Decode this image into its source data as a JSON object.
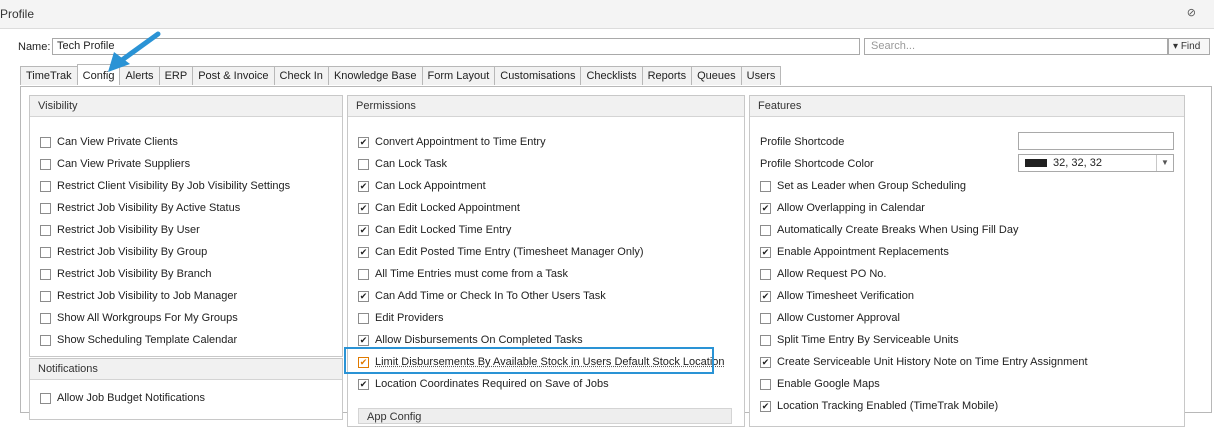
{
  "window": {
    "title": "Profile",
    "close": "⊘"
  },
  "name_row": {
    "label": "Name:",
    "value": "Tech Profile",
    "search_placeholder": "Search...",
    "find_label": "Find"
  },
  "tabs": [
    "TimeTrak",
    "Config",
    "Alerts",
    "ERP",
    "Post & Invoice",
    "Check In",
    "Knowledge Base",
    "Form Layout",
    "Customisations",
    "Checklists",
    "Reports",
    "Queues",
    "Users"
  ],
  "visibility": {
    "header": "Visibility",
    "items": [
      {
        "label": "Can View Private Clients",
        "checked": false
      },
      {
        "label": "Can View Private Suppliers",
        "checked": false
      },
      {
        "label": "Restrict Client Visibility By Job Visibility Settings",
        "checked": false
      },
      {
        "label": "Restrict Job Visibility By Active Status",
        "checked": false
      },
      {
        "label": "Restrict Job Visibility By User",
        "checked": false
      },
      {
        "label": "Restrict Job Visibility By Group",
        "checked": false
      },
      {
        "label": "Restrict Job Visibility By Branch",
        "checked": false
      },
      {
        "label": "Restrict Job Visibility to Job Manager",
        "checked": false
      },
      {
        "label": "Show All Workgroups For My Groups",
        "checked": false
      },
      {
        "label": "Show Scheduling Template Calendar",
        "checked": false
      }
    ]
  },
  "notifications": {
    "header": "Notifications",
    "items": [
      {
        "label": "Allow Job Budget Notifications",
        "checked": false
      }
    ]
  },
  "permissions": {
    "header": "Permissions",
    "items": [
      {
        "label": "Convert Appointment to Time Entry",
        "checked": true
      },
      {
        "label": "Can Lock Task",
        "checked": false
      },
      {
        "label": "Can Lock Appointment",
        "checked": true
      },
      {
        "label": "Can Edit Locked Appointment",
        "checked": true
      },
      {
        "label": "Can Edit Locked Time Entry",
        "checked": true
      },
      {
        "label": "Can Edit Posted Time Entry (Timesheet Manager Only)",
        "checked": true
      },
      {
        "label": "All Time Entries must come from a Task",
        "checked": false
      },
      {
        "label": "Can Add Time or Check In To Other Users Task",
        "checked": true
      },
      {
        "label": "Edit Providers",
        "checked": false
      },
      {
        "label": "Allow Disbursements On Completed Tasks",
        "checked": true
      },
      {
        "label": "Limit Disbursements By Available Stock in Users Default Stock Location",
        "checked": true
      },
      {
        "label": "Location Coordinates Required on Save of Jobs",
        "checked": true
      }
    ],
    "app_config": "App Config"
  },
  "features": {
    "header": "Features",
    "shortcode_label": "Profile Shortcode",
    "shortcode_color_label": "Profile Shortcode Color",
    "shortcode_color_value": "32, 32, 32",
    "shortcode_color_hex": "#202020",
    "items": [
      {
        "label": "Set as Leader when Group Scheduling",
        "checked": false
      },
      {
        "label": "Allow Overlapping in Calendar",
        "checked": true
      },
      {
        "label": "Automatically Create Breaks When Using Fill Day",
        "checked": false
      },
      {
        "label": "Enable Appointment Replacements",
        "checked": true
      },
      {
        "label": "Allow Request PO No.",
        "checked": false
      },
      {
        "label": "Allow Timesheet Verification",
        "checked": true
      },
      {
        "label": "Allow Customer Approval",
        "checked": false
      },
      {
        "label": "Split Time Entry By Serviceable Units",
        "checked": false
      },
      {
        "label": "Create Serviceable Unit History Note on Time Entry Assignment",
        "checked": true
      },
      {
        "label": "Enable Google Maps",
        "checked": false
      },
      {
        "label": "Location Tracking Enabled (TimeTrak Mobile)",
        "checked": true
      }
    ]
  },
  "colors": {
    "highlight": "#2a93d5",
    "arrow": "#2a93d5"
  }
}
